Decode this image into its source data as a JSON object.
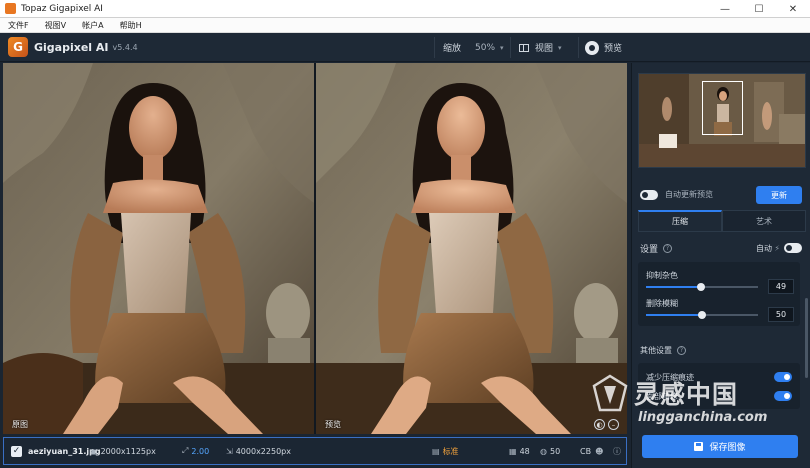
{
  "window": {
    "title": "Topaz Gigapixel AI",
    "minimize": "—",
    "maximize": "☐",
    "close": "✕"
  },
  "menu": {
    "items": [
      "文件F",
      "视图V",
      "帐户A",
      "帮助H"
    ]
  },
  "toolbar": {
    "logo_letter": "G",
    "app_name": "Gigapixel AI",
    "version": "v5.4.4",
    "zoom_label": "缩放",
    "zoom_value": "50%",
    "view_label": "视图",
    "preview_label": "预览"
  },
  "panes": {
    "left_label": "原图",
    "right_label": "预览"
  },
  "statusbar": {
    "check": "✓",
    "filename": "aeziyuan_31.jpg",
    "input_size": "2000x1125px",
    "scale": "2.00",
    "output_size": "4000x2250px",
    "mode": "标准",
    "noise_value": "48",
    "blur_value": "50",
    "cb_label": "CB"
  },
  "sidebar": {
    "auto_update_label": "自动更新预览",
    "update_button": "更新",
    "tabs": [
      "压缩",
      "艺术"
    ],
    "settings_label": "设置",
    "auto_label": "自动",
    "sliders": [
      {
        "label": "抑制杂色",
        "value": "49",
        "fraction": 0.49
      },
      {
        "label": "删除模糊",
        "value": "50",
        "fraction": 0.5
      }
    ],
    "other_settings_label": "其他设置",
    "other_items": [
      "减少压缩痕迹",
      "面部精修"
    ],
    "save_button": "保存图像"
  },
  "watermark": {
    "title": "灵感中国",
    "url": "lingganchina.com"
  },
  "colors": {
    "accent": "#2f7ff0",
    "panel": "#1e2936",
    "background": "#1b2531",
    "brand_orange": "#f08a24"
  },
  "icons": [
    "app-icon",
    "view-split-icon",
    "eye-icon",
    "file-size-icon",
    "scale-icon",
    "output-size-icon",
    "mode-icon",
    "noise-icon",
    "blur-icon",
    "face-icon",
    "help-icon",
    "lightning-icon",
    "save-icon"
  ]
}
